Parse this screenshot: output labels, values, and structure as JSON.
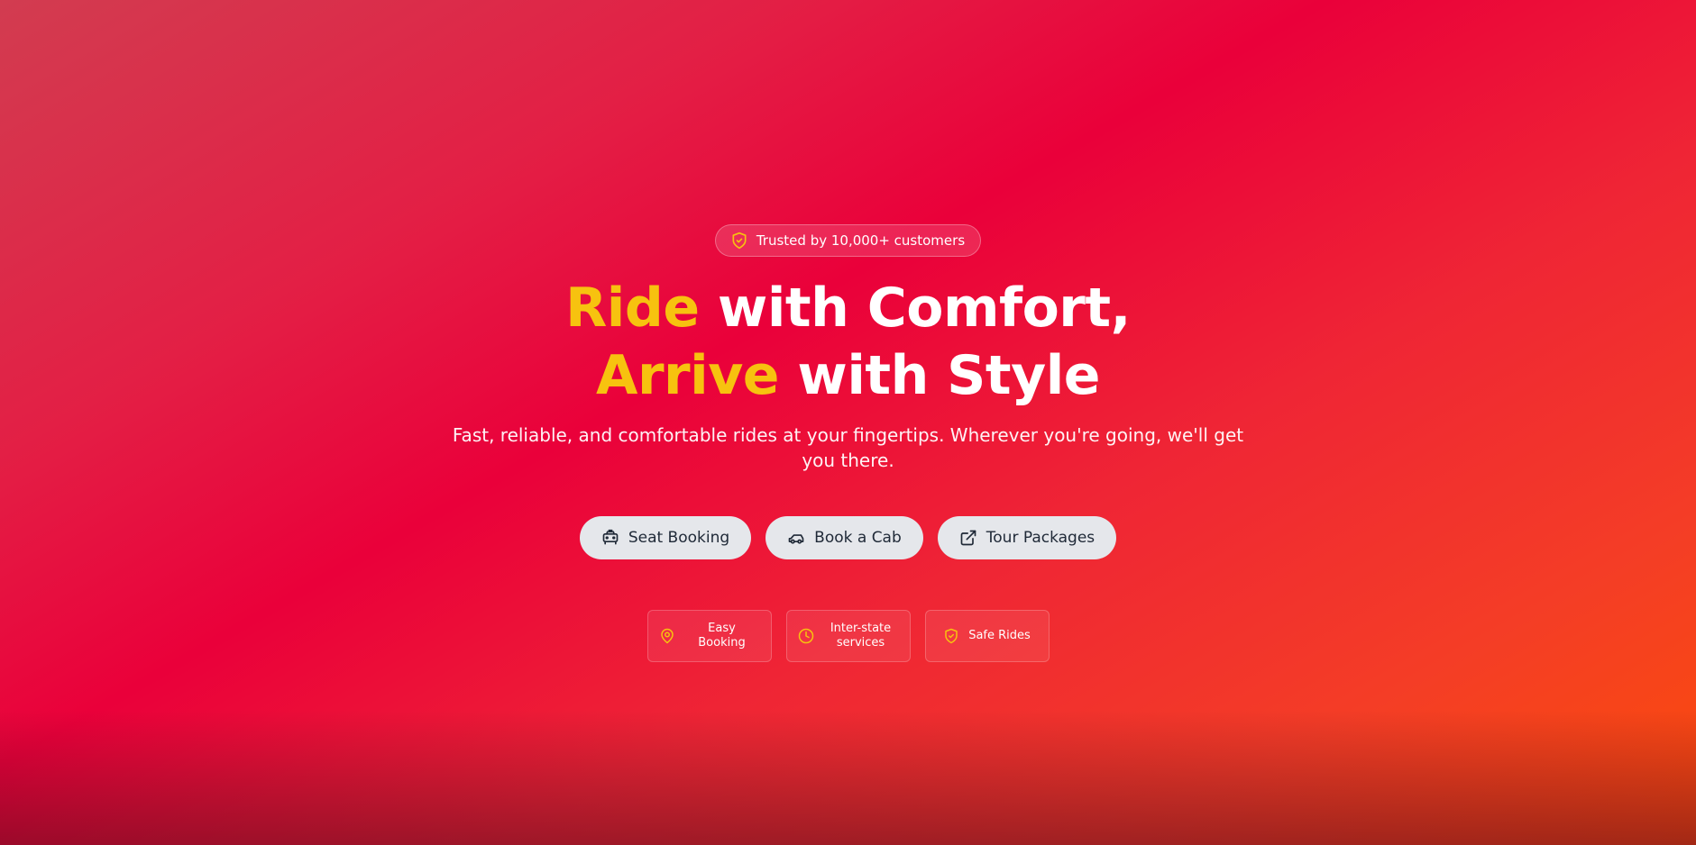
{
  "hero": {
    "badge": {
      "icon": "shield-check-icon",
      "text": "Trusted by 10,000+ customers"
    },
    "headline": {
      "line1_accent": "Ride",
      "line1_rest": " with Comfort,",
      "line2_accent": "Arrive",
      "line2_rest": " with Style"
    },
    "subtitle": "Fast, reliable, and comfortable rides at your fingertips. Wherever you're going, we'll get you there.",
    "actions": [
      {
        "icon": "taxi-icon",
        "label": "Seat Booking"
      },
      {
        "icon": "car-icon",
        "label": "Book a Cab"
      },
      {
        "icon": "external-link-icon",
        "label": "Tour Packages"
      }
    ],
    "features": [
      {
        "icon": "map-pin-icon",
        "label": "Easy Booking"
      },
      {
        "icon": "clock-icon",
        "label": "Inter-state services"
      },
      {
        "icon": "shield-check-icon",
        "label": "Safe Rides"
      }
    ]
  },
  "colors": {
    "accent": "#f7c20f",
    "background_start": "#d23c50",
    "background_mid": "#ea003a",
    "background_end": "#fb4d0a",
    "button_bg": "#e5e7eb",
    "button_text": "#1f2937"
  }
}
